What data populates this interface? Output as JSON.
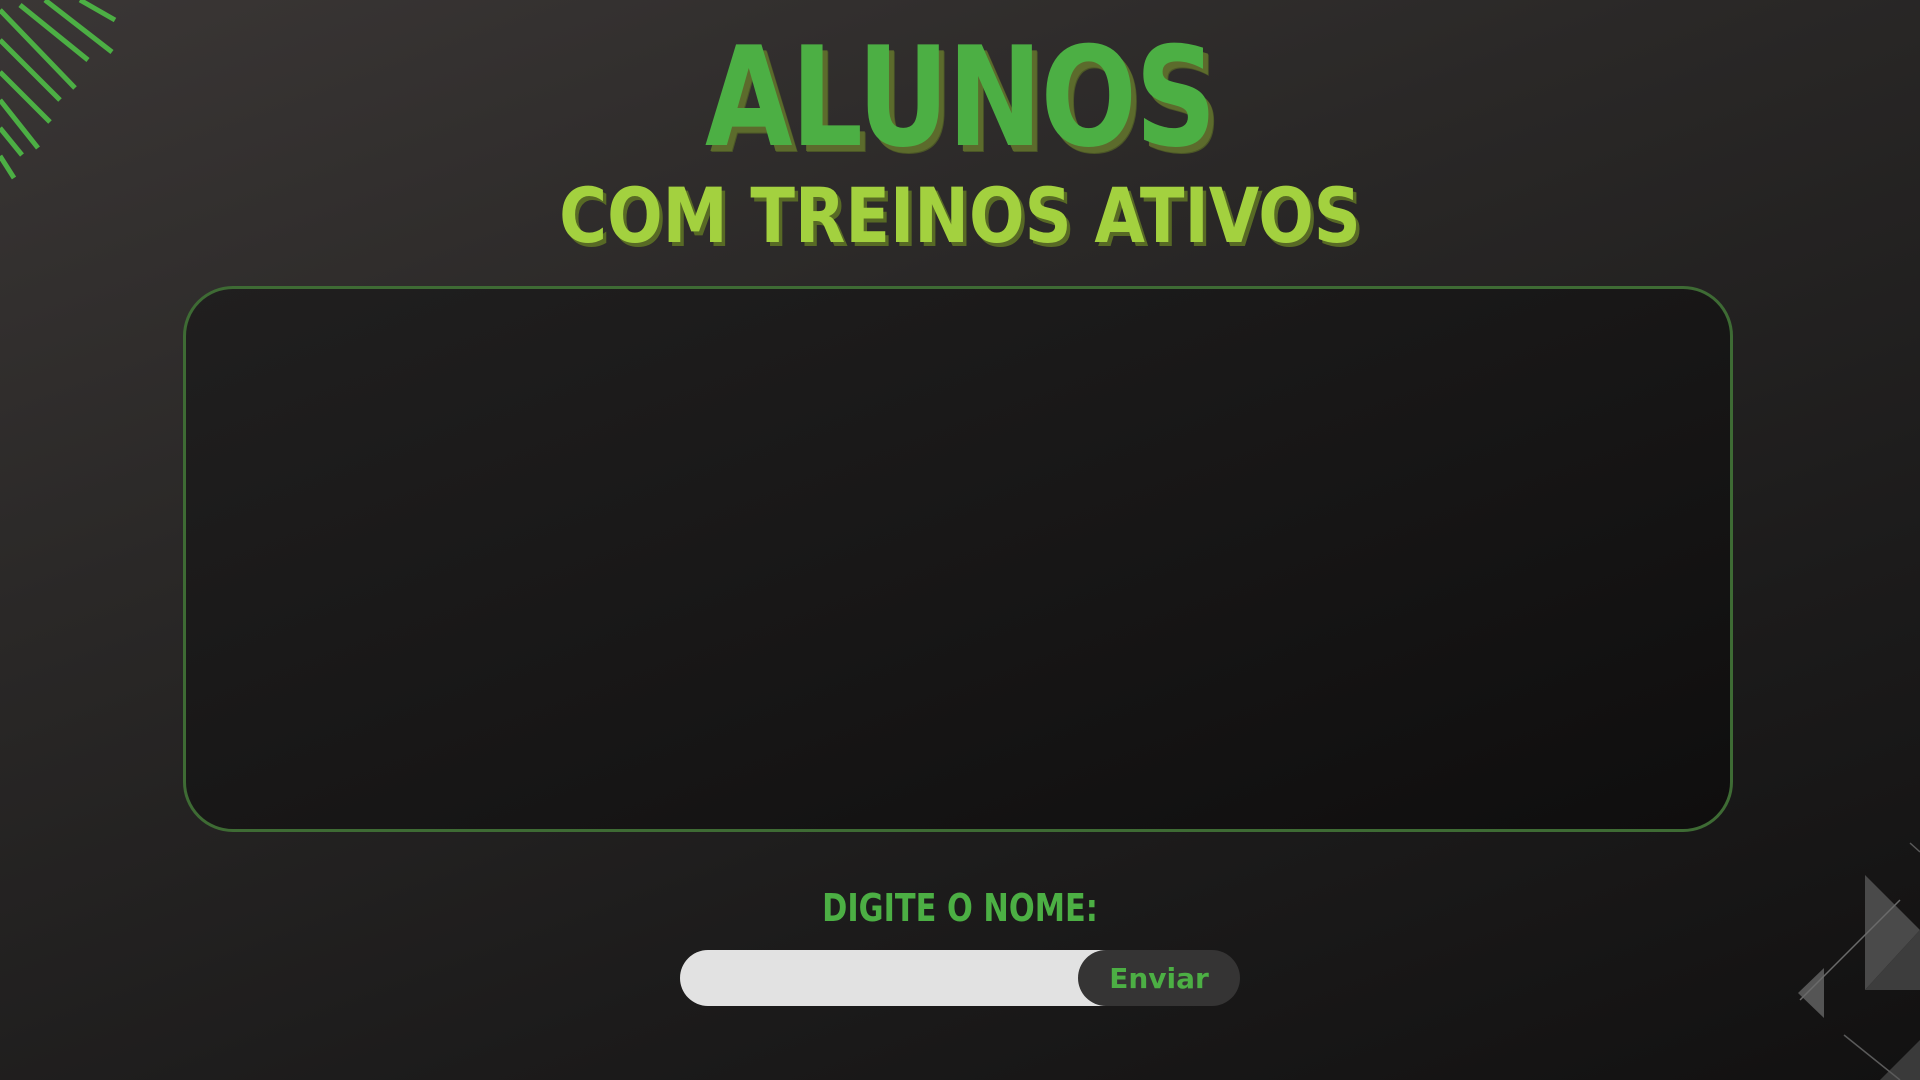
{
  "header": {
    "title": "ALUNOS",
    "subtitle": "COM TREINOS ATIVOS"
  },
  "form": {
    "prompt_label": "DIGITE O NOME:",
    "name_input_value": "",
    "send_label": "Enviar"
  },
  "colors": {
    "accent_green": "#4caf44",
    "subtitle_lime": "#a3d13f",
    "panel_border": "#3e6b34",
    "background_dark": "#1c1b1b"
  },
  "icons": {
    "top_left_decoration": "diagonal-stripes-icon",
    "bottom_right_decoration": "triangle-shapes-icon"
  }
}
